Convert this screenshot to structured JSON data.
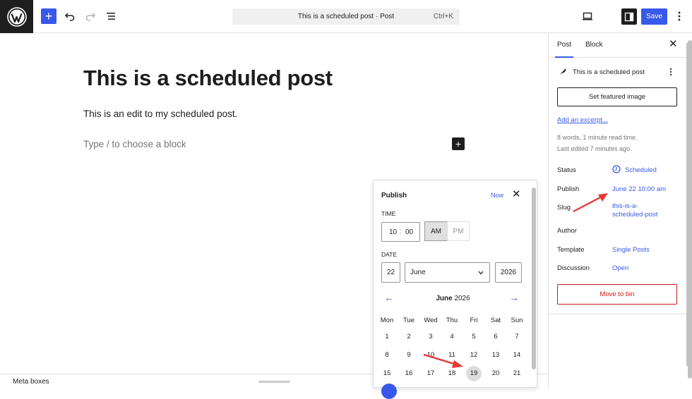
{
  "topbar": {
    "command_title": "This is a scheduled post · Post",
    "shortcut": "Ctrl+K",
    "save_label": "Save",
    "add_label": "+"
  },
  "editor": {
    "title": "This is a scheduled post",
    "paragraph": "This is an edit to my scheduled post.",
    "placeholder": "Type / to choose a block",
    "inserter": "+"
  },
  "metabar": {
    "label": "Meta boxes"
  },
  "sidebar": {
    "tabs": [
      "Post",
      "Block"
    ],
    "post_name": "This is a scheduled post",
    "featured_image": "Set featured image",
    "excerpt_link": "Add an excerpt...",
    "stats": "8 words, 1 minute read time.",
    "last_edited": "Last edited 7 minutes ago.",
    "rows": [
      {
        "label": "Status",
        "value": "Scheduled"
      },
      {
        "label": "Publish",
        "value": "June 22 10:00 am"
      },
      {
        "label": "Slug",
        "value": "this-is-a-scheduled-post",
        "value_line1": "this-is-a-",
        "value_line2": "scheduled-post"
      },
      {
        "label": "Author",
        "value": ""
      },
      {
        "label": "Template",
        "value": "Single Posts"
      },
      {
        "label": "Discussion",
        "value": "Open"
      }
    ],
    "move_to_bin": "Move to bin"
  },
  "publish_popover": {
    "title": "Publish",
    "now": "Now",
    "time_label": "TIME",
    "hour": "10",
    "minute": "00",
    "am": "AM",
    "pm": "PM",
    "date_label": "DATE",
    "day": "22",
    "month": "June",
    "year": "2026",
    "calendar_month": "June",
    "calendar_year": "2026",
    "weekdays": [
      "Mon",
      "Tue",
      "Wed",
      "Thu",
      "Fri",
      "Sat",
      "Sun"
    ],
    "weeks": [
      [
        "1",
        "2",
        "3",
        "4",
        "5",
        "6",
        "7"
      ],
      [
        "8",
        "9",
        "10",
        "11",
        "12",
        "13",
        "14"
      ],
      [
        "15",
        "16",
        "17",
        "18",
        "19",
        "20",
        "21"
      ]
    ],
    "today": "19"
  },
  "colors": {
    "accent": "#3858e9",
    "danger": "#cc1818",
    "arrow": "#e53935"
  }
}
